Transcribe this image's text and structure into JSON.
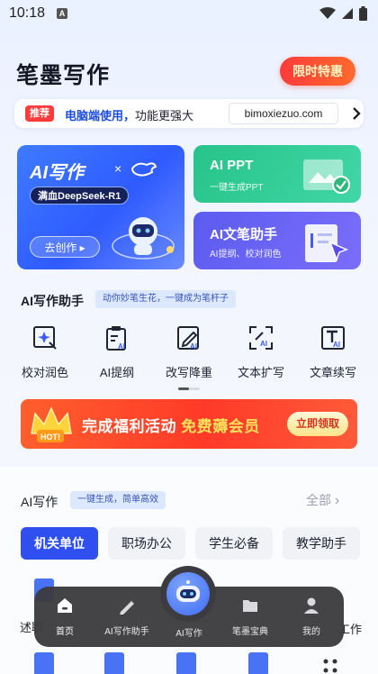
{
  "status_bar": {
    "time": "10:18",
    "notif": "A"
  },
  "header": {
    "title": "笔墨写作",
    "promo_label": "限时特惠"
  },
  "pc_bar": {
    "badge": "推荐",
    "text_bold": "电脑端使用，",
    "text_rest": "功能更强大",
    "url": "bimoxiezuo.com"
  },
  "cards": {
    "big": {
      "title": "AI写作",
      "times": "×",
      "badge": "满血DeepSeek-R1",
      "button": "去创作 ▸"
    },
    "ppt": {
      "title": "AI PPT",
      "subtitle": "一键生成PPT"
    },
    "pen": {
      "title": "AI文笔助手",
      "subtitle": "AI提纲、校对润色"
    }
  },
  "assistant": {
    "title": "AI写作助手",
    "tagline": "动你妙笔生花，一键成为笔杆子",
    "tools": [
      {
        "label": "校对润色",
        "icon": "sparkle-edit-icon"
      },
      {
        "label": "AI提纲",
        "icon": "clipboard-ai-icon"
      },
      {
        "label": "改写降重",
        "icon": "pen-edit-icon"
      },
      {
        "label": "文本扩写",
        "icon": "expand-ai-icon"
      },
      {
        "label": "文章续写",
        "icon": "text-ai-icon"
      }
    ]
  },
  "banner": {
    "text_a": "完成福利活动 ",
    "text_b": "免费薅会员",
    "button": "立即领取",
    "hot": "HOT!"
  },
  "writing": {
    "title": "AI写作",
    "tagline": "一键生成，简单高效",
    "all_label": "全部",
    "categories": [
      "机关单位",
      "职场办公",
      "学生必备",
      "教学助手"
    ],
    "peek_left": "述职",
    "peek_right": "工作"
  },
  "tabbar": {
    "items": [
      {
        "label": "首页",
        "icon": "home-icon"
      },
      {
        "label": "AI写作助手",
        "icon": "pen-icon"
      },
      {
        "label": "AI写作",
        "icon": "robot-icon"
      },
      {
        "label": "笔墨宝典",
        "icon": "folder-icon"
      },
      {
        "label": "我的",
        "icon": "user-icon"
      }
    ]
  },
  "colors": {
    "primary": "#2f4ff0",
    "promo": "#ff3b3b",
    "tabbar": "#3c3c40"
  }
}
